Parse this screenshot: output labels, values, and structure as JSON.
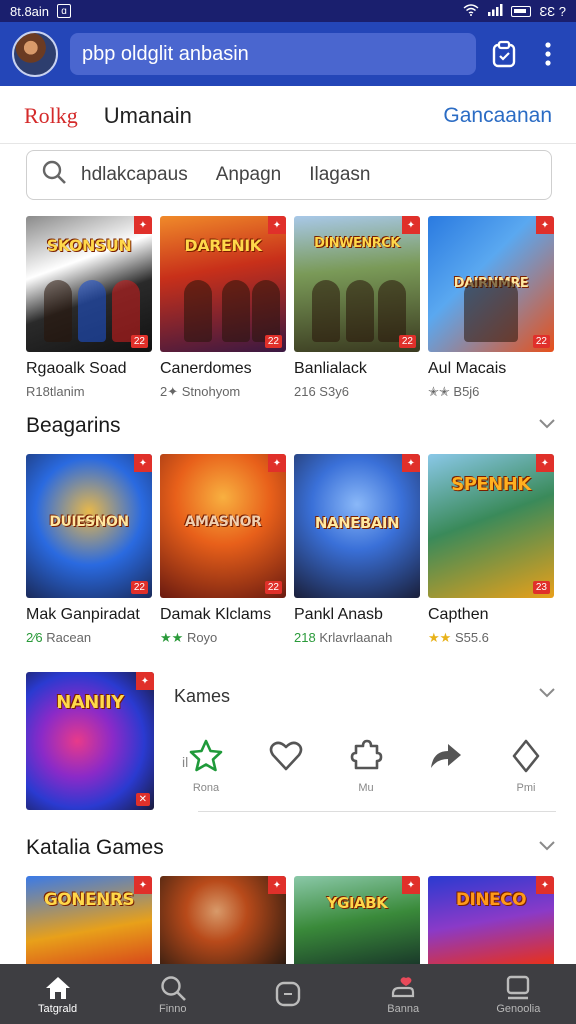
{
  "status_bar": {
    "time": "8t.8ain",
    "right_text": "ƐƐ ?"
  },
  "top_bar": {
    "search_text": "pbp oldglit anbasin"
  },
  "header": {
    "brand": "Rolkg",
    "title": "Umanain",
    "link": "Gancaanan"
  },
  "search": {
    "text1": "hdlakcapaus",
    "text2": "Anpagn",
    "text3": "Ilagasn"
  },
  "row1": [
    {
      "thumb_title": "SKONSUN",
      "name": "Rgaoalk Soad",
      "sub": "R18tlanim",
      "badge": "22",
      "colors": [
        "#6a6a6a",
        "#1e1e1e"
      ]
    },
    {
      "thumb_title": "DARENIK",
      "name": "Canerdomes",
      "sub": "2✦ Stnohyom",
      "badge": "22",
      "colors": [
        "#e35a1a",
        "#3a1842"
      ]
    },
    {
      "thumb_title": "DINWENRCK",
      "name": "Banlialack",
      "sub": "216 S3y6",
      "badge": "22",
      "colors": [
        "#7a9a58",
        "#3a3a20"
      ]
    },
    {
      "thumb_title": "DAIRNMRE",
      "name": "Aul Macais",
      "sub": "✭✭ B5j6",
      "badge": "22",
      "colors": [
        "#3a8ae0",
        "#e84a1a"
      ]
    }
  ],
  "section2": {
    "title": "Beagarins"
  },
  "row2": [
    {
      "thumb_title": "DUIESNON",
      "name": "Mak Ganpiradat",
      "sub_star": "2⁄6",
      "sub": "Racean",
      "badge": "22",
      "colors": [
        "#2a6ae0",
        "#c8901a"
      ]
    },
    {
      "thumb_title": "AMASNOR",
      "name": "Damak Klclams",
      "sub_star": "★★",
      "sub": "Royo",
      "badge": "22",
      "colors": [
        "#e8801a",
        "#6a1a10"
      ]
    },
    {
      "thumb_title": "NANEBAIN",
      "name": "Pankl Anasb",
      "sub_star": "218",
      "sub": "Krlavrlaanah",
      "badge": "",
      "colors": [
        "#3a70d8",
        "#1a1f3a"
      ]
    },
    {
      "thumb_title": "SPENHK",
      "name": "Capthen",
      "sub_star": "★★",
      "sub": "S55.6",
      "badge": "23",
      "colors": [
        "#3a8a5a",
        "#e8a01a"
      ]
    }
  ],
  "share": {
    "thumb_title": "NANIIY",
    "title": "Kames",
    "leading": "il",
    "actions": [
      {
        "icon": "star-icon",
        "label": "Rona"
      },
      {
        "icon": "heart-icon",
        "label": ""
      },
      {
        "icon": "puzzle-icon",
        "label": "Mu"
      },
      {
        "icon": "share-arrow-icon",
        "label": ""
      },
      {
        "icon": "diamond-icon",
        "label": "Pmi"
      }
    ]
  },
  "section3": {
    "title": "Katalia Games"
  },
  "row3": [
    {
      "thumb_title": "GONENRS",
      "colors": [
        "#e8a01a",
        "#2a5ad0"
      ]
    },
    {
      "thumb_title": "",
      "colors": [
        "#b84a1a",
        "#2a1a10"
      ]
    },
    {
      "thumb_title": "YGIABK",
      "colors": [
        "#3a8a3a",
        "#1a3a2a"
      ]
    },
    {
      "thumb_title": "DINECO",
      "colors": [
        "#2a3ad0",
        "#e8301a"
      ]
    }
  ],
  "bottom_nav": [
    {
      "label": "Tatgrald",
      "icon": "home-icon",
      "active": true
    },
    {
      "label": "Finno",
      "icon": "search-icon",
      "active": false
    },
    {
      "label": "",
      "icon": "square-icon",
      "active": false
    },
    {
      "label": "Banna",
      "icon": "hand-icon",
      "active": false
    },
    {
      "label": "Genoolia",
      "icon": "chat-icon",
      "active": false
    }
  ]
}
